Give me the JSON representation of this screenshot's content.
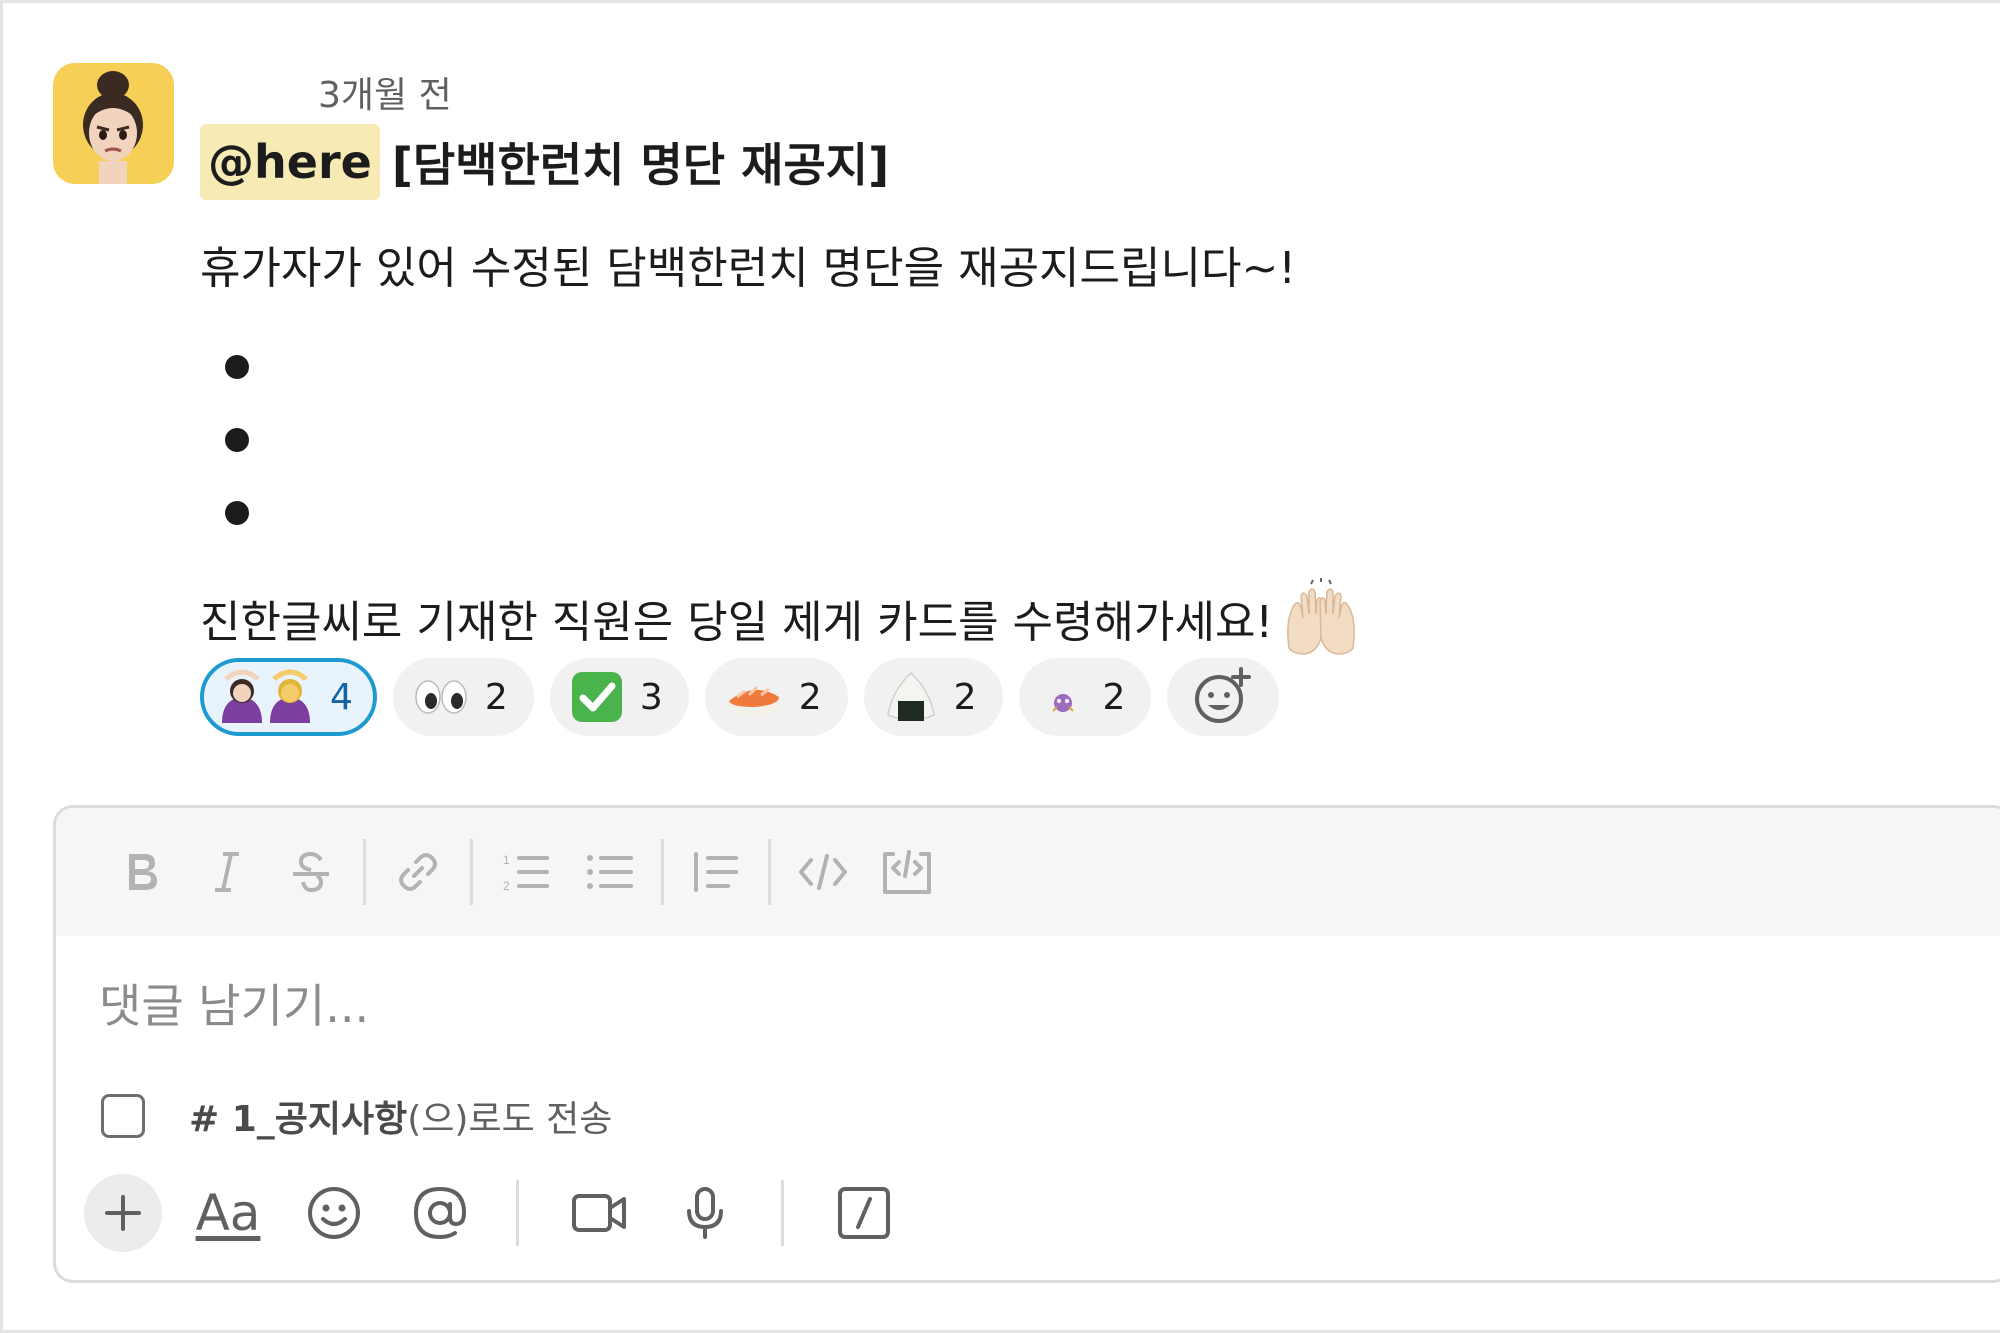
{
  "message": {
    "timestamp": "3개월 전",
    "mention": "@here",
    "title": "[담백한런치 명단 재공지]",
    "line1": "휴가자가 있어 수정된 담백한런치 명단을 재공지드립니다~!",
    "line2": "진한글씨로 기재한 직원은 당일 제게 카드를 수령해가세요!"
  },
  "reactions": [
    {
      "icon": "person-gesturing-ok-emoji",
      "count": "4",
      "active": true
    },
    {
      "icon": "eyes-emoji",
      "count": "2"
    },
    {
      "icon": "check-mark-button-emoji",
      "count": "3"
    },
    {
      "icon": "sushi-emoji",
      "count": "2"
    },
    {
      "icon": "rice-ball-emoji",
      "count": "2"
    },
    {
      "icon": "small-emoji",
      "count": "2"
    }
  ],
  "composer": {
    "placeholder": "댓글 남기기...",
    "also_send_channel": "# 1_공지사항",
    "also_send_suffix": "(으)로도 전송",
    "format_label": "Aa"
  },
  "colors": {
    "mention_bg": "#f8eab4",
    "reaction_active_border": "#1d9bd1",
    "avatar_bg": "#f6d056"
  }
}
